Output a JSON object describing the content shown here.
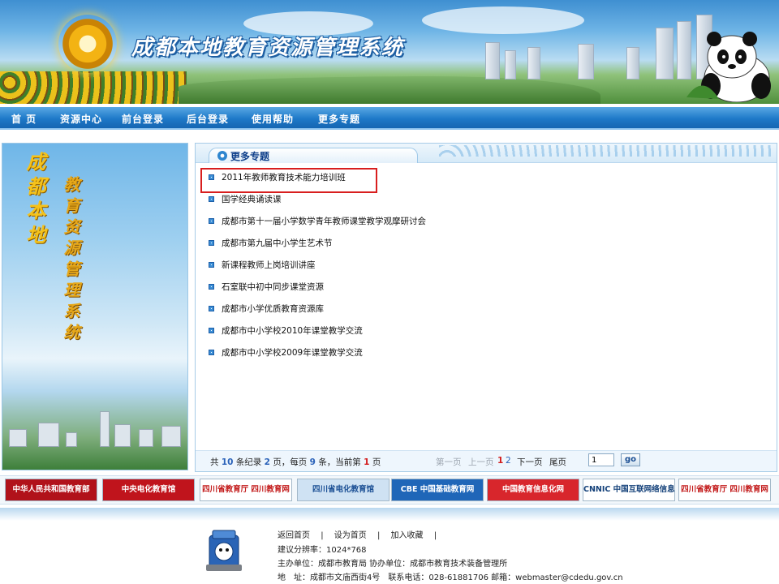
{
  "site": {
    "title": "成都本地教育资源管理系统",
    "side_title_left": "成都本地",
    "side_title_right": "教育资源管理系统"
  },
  "nav": {
    "items": [
      {
        "label": "首 页",
        "name": "nav-home"
      },
      {
        "label": "资源中心",
        "name": "nav-resource-center"
      },
      {
        "label": "前台登录",
        "name": "nav-front-login"
      },
      {
        "label": "后台登录",
        "name": "nav-admin-login"
      },
      {
        "label": "使用帮助",
        "name": "nav-help"
      },
      {
        "label": "更多专题",
        "name": "nav-more-topics"
      }
    ]
  },
  "main": {
    "section_title": "更多专题",
    "topics": [
      "2011年教师教育技术能力培训班",
      "国学经典诵读课",
      "成都市第十一届小学数学青年教师课堂教学观摩研讨会",
      "成都市第九届中小学生艺术节",
      "新课程教师上岗培训讲座",
      "石室联中初中同步课堂资源",
      "成都市小学优质教育资源库",
      "成都市中小学校2010年课堂教学交流",
      "成都市中小学校2009年课堂教学交流"
    ],
    "highlighted_index": 0
  },
  "pager": {
    "prefix": "共",
    "total_records": "10",
    "records_unit": "条纪录",
    "total_pages": "2",
    "pages_unit": "页，每页",
    "per_page": "9",
    "per_page_unit": "条，当前第",
    "current_page": "1",
    "current_unit": "页",
    "first_label": "第一页",
    "prev_label": "上一页",
    "page_1": "1",
    "page_2": "2",
    "next_label": "下一页",
    "last_label": "尾页",
    "input_value": "1",
    "go_label": "go"
  },
  "partners": [
    {
      "label": "中华人民共和国教育部",
      "bg": "#b1121a",
      "fg": "#ffffff"
    },
    {
      "label": "中央电化教育馆",
      "bg": "#c0141c",
      "fg": "#ffffff"
    },
    {
      "label": "四川省教育厅 四川教育网",
      "bg": "#ffffff",
      "fg": "#c31b1b"
    },
    {
      "label": "四川省电化教育馆",
      "bg": "#cfe2f3",
      "fg": "#1b4f94"
    },
    {
      "label": "CBE 中国基础教育网",
      "bg": "#1f66b8",
      "fg": "#ffffff"
    },
    {
      "label": "中国教育信息化网",
      "bg": "#d8262c",
      "fg": "#ffffff"
    },
    {
      "label": "CNNIC 中国互联网络信息中心",
      "bg": "#ffffff",
      "fg": "#14417a"
    },
    {
      "label": "四川省教育厅 四川教育网",
      "bg": "#ffffff",
      "fg": "#c31b1b"
    }
  ],
  "footer": {
    "links": [
      "返回首页",
      "设为首页",
      "加入收藏"
    ],
    "resolution": "建议分辨率：1024*768",
    "sponsor": "主办单位：成都市教育局 协办单位：成都市教育技术装备管理所",
    "address": "地　址：成都市文庙西街4号　联系电话：028-61881706 邮箱：webmaster@cdedu.gov.cn"
  },
  "colors": {
    "nav_bg": "#1e79c8",
    "highlight_outline": "#d81e1e",
    "current_page": "#d21a1a",
    "number_blue": "#2a62b9"
  }
}
